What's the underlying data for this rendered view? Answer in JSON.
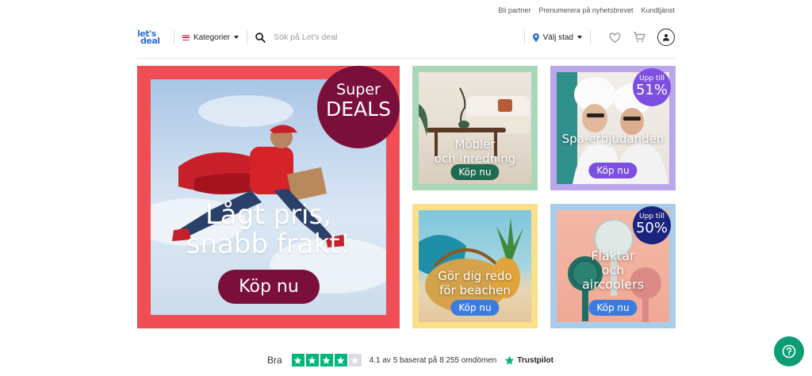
{
  "topbar": {
    "links": [
      "Bli partner",
      "Prenumerera på nyhetsbrevet",
      "Kundtjänst"
    ]
  },
  "header": {
    "logo_line1": "let's",
    "logo_line2": "deal",
    "categories_label": "Kategorier",
    "search_placeholder": "Sök på Let's deal",
    "city_label": "Välj stad"
  },
  "hero": {
    "badge_line1": "Super",
    "badge_line2": "DEALS",
    "headline_line1": "Lågt pris,",
    "headline_line2": "snabb frakt!",
    "button": "Köp nu"
  },
  "tiles": [
    {
      "title_line1": "Möbler",
      "title_line2": "och inredning",
      "button": "Köp nu",
      "frame_color": "#a8d8b8",
      "button_color": "#1f6b52"
    },
    {
      "badge_line1": "Upp till",
      "badge_line2": "51%",
      "title_line1": "Spa-erbjudanden",
      "button": "Köp nu",
      "frame_color": "#b9a7ea",
      "button_color": "#7c4fe0"
    },
    {
      "title_line1": "Gör dig redo",
      "title_line2": "för beachen",
      "button": "Köp nu",
      "frame_color": "#fbe08a",
      "button_color": "#3b7be0"
    },
    {
      "badge_line1": "Upp till",
      "badge_line2": "50%",
      "title_line1": "Fläktar",
      "title_line2": "och",
      "title_line3": "aircoolers",
      "button": "Köp nu",
      "frame_color": "#a9cde8",
      "button_color": "#3b7be0"
    }
  ],
  "trustpilot": {
    "rating_word": "Bra",
    "rating_stars": 4.1,
    "summary": "4.1 av 5 baserat på 8 255 omdömen",
    "brand": "Trustpilot"
  },
  "colors": {
    "hero_frame": "#f04e54",
    "hero_accent": "#7a0f3b",
    "trust_green": "#00b67a",
    "help_button": "#0d9d74"
  }
}
